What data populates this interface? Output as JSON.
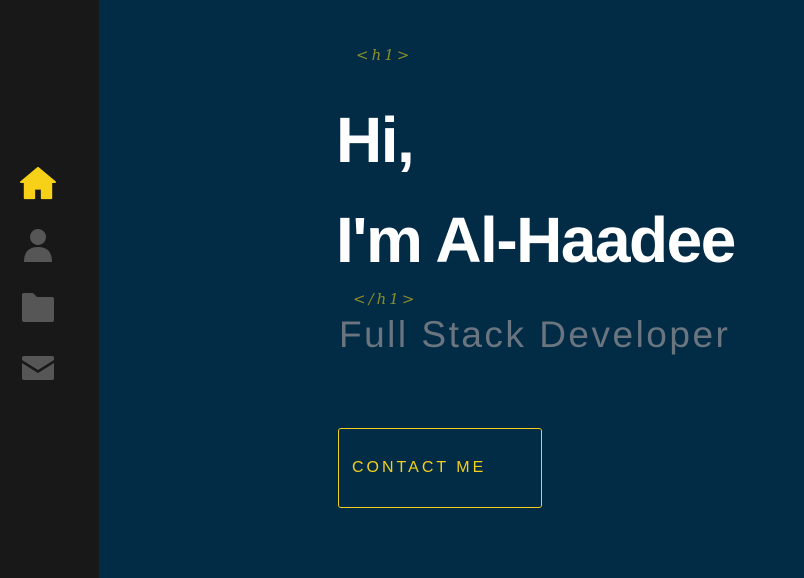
{
  "sidebar": {
    "items": [
      {
        "icon": "home-icon",
        "active": true,
        "color": "#f7d117"
      },
      {
        "icon": "user-icon",
        "active": false,
        "color": "#565656"
      },
      {
        "icon": "folder-icon",
        "active": false,
        "color": "#565656"
      },
      {
        "icon": "envelope-icon",
        "active": false,
        "color": "#565656"
      }
    ]
  },
  "hero": {
    "open_tag": "<h1>",
    "line1": "Hi,",
    "line2": "I'm Al-Haadee",
    "close_tag": "</h1>",
    "subtitle": "Full Stack Developer",
    "cta_label": "CONTACT ME"
  },
  "colors": {
    "sidebar_bg": "#181818",
    "main_bg": "#022b45",
    "accent": "#f2cf1c",
    "tag_color": "#8a8f2a",
    "heading": "#ffffff",
    "subtitle": "#6a7580"
  }
}
